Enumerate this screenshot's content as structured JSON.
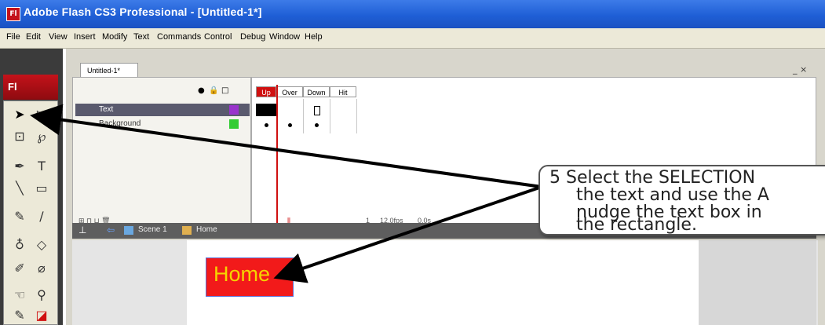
{
  "titlebar": {
    "title": "Adobe Flash CS3 Professional - [Untitled-1*]",
    "icon": "Fl"
  },
  "menubar": [
    "File",
    "Edit",
    "View",
    "Insert",
    "Modify",
    "Text",
    "Commands",
    "Control",
    "Debug",
    "Window",
    "Help"
  ],
  "tools_panel": {
    "logo": "Fl",
    "icons": [
      "selection-arrow",
      "subselection",
      "free-transform",
      "lasso",
      "pen",
      "text",
      "line",
      "rectangle",
      "pencil",
      "brush",
      "ink-bottle",
      "paint-bucket",
      "eyedropper",
      "eraser",
      "hand",
      "zoom",
      "stroke-color",
      "fill-color"
    ]
  },
  "document": {
    "tab_label": "Untitled-1*",
    "window_controls": "_ ×"
  },
  "timeline": {
    "frame_headers": [
      "Up",
      "Over",
      "Down",
      "Hit"
    ],
    "layers": [
      {
        "name": "Text"
      },
      {
        "name": "Background"
      }
    ],
    "status": {
      "frame": "1",
      "fps": "12.0fps",
      "time": "0.0s"
    }
  },
  "scene_bar": {
    "scene": "Scene 1",
    "symbol": "Home"
  },
  "stage": {
    "button_text": "Home",
    "button_color": "#f21a1a",
    "text_color": "#f5d400"
  },
  "callout": {
    "line1": "5  Select the SELECTION",
    "line2": "the text and use the A",
    "line3": "nudge the text box in",
    "line4": "the rectangle."
  }
}
